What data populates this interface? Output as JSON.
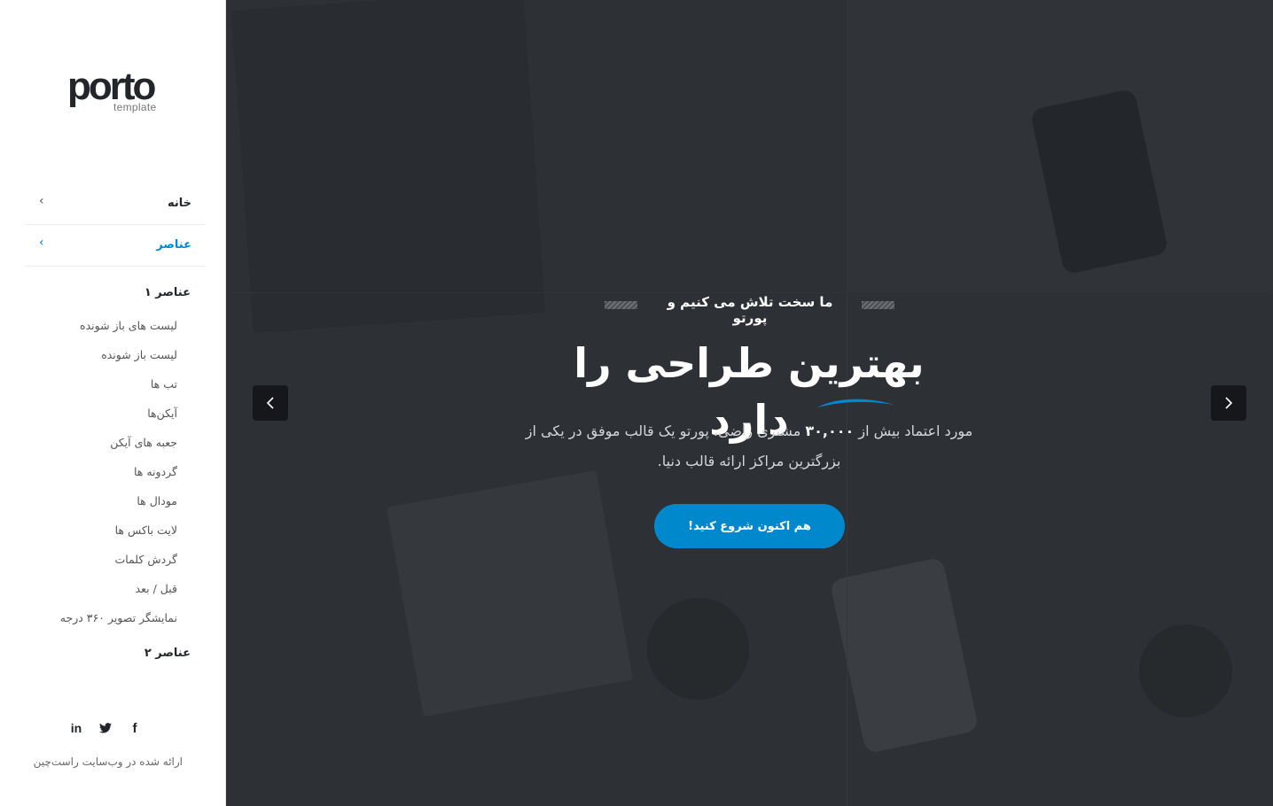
{
  "brand": {
    "logo_text": "porto",
    "logo_subtext": "template"
  },
  "sidebar": {
    "top_items": [
      {
        "label": "خانه",
        "active": false
      },
      {
        "label": "عناصر",
        "active": true
      }
    ],
    "groups": [
      {
        "title": "عناصر ۱",
        "items": [
          "لیست های باز شونده",
          "لیست باز شونده",
          "تب ها",
          "آیکن‌ها",
          "جعبه های آیکن",
          "گردونه ها",
          "مودال ها",
          "لایت باکس ها",
          "گردش کلمات",
          "قبل / بعد",
          "نمایشگر تصویر ۳۶۰ درجه"
        ]
      },
      {
        "title": "عناصر ۲",
        "items": []
      }
    ],
    "socials": [
      {
        "name": "linkedin-icon",
        "glyph": "in"
      },
      {
        "name": "twitter-icon",
        "glyph": "twitter"
      },
      {
        "name": "facebook-icon",
        "glyph": "f"
      }
    ],
    "footer_note": "ارائه شده در وب‌سایت راست‌چین"
  },
  "hero": {
    "pre_title": "ما سخت تلاش می کنیم و پورتو",
    "title": "بهترین طراحی را دارد",
    "description_before": "مورد اعتماد بیش از",
    "description_bold": "۳۰,۰۰۰",
    "description_after": "مشتری راضی، پورتو یک قالب موفق در یکی از بزرگترین مراکز ارائه قالب دنیا.",
    "cta_label": "هم اکنون شروع کنید!",
    "prev_arrow": "chevron-left-icon",
    "next_arrow": "chevron-right-icon"
  },
  "colors": {
    "accent": "#0088cc",
    "sidebar_bg": "#ffffff",
    "hero_bg": "#34373c",
    "text_dark": "#222529"
  }
}
